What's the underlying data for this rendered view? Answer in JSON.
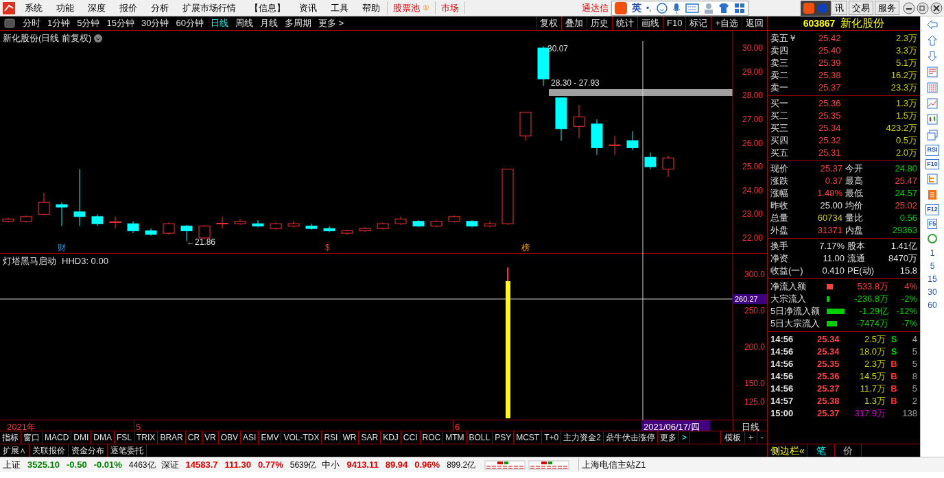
{
  "menu": {
    "items": [
      "系统",
      "功能",
      "深度",
      "报价",
      "分析",
      "扩展市场行情",
      "【信息】",
      "资讯",
      "工具",
      "帮助"
    ],
    "pool": "股票池",
    "pool_badge": "①",
    "market": "市场",
    "title": "通达信",
    "right_buttons": [
      "讯",
      "交易",
      "服务"
    ]
  },
  "ime_bar": {
    "label": "英",
    "punct": "•,"
  },
  "periods": [
    {
      "label": "分时",
      "selected": false
    },
    {
      "label": "1分钟",
      "selected": false
    },
    {
      "label": "5分钟",
      "selected": false
    },
    {
      "label": "15分钟",
      "selected": false
    },
    {
      "label": "30分钟",
      "selected": false
    },
    {
      "label": "60分钟",
      "selected": false
    },
    {
      "label": "日线",
      "selected": true
    },
    {
      "label": "周线",
      "selected": false
    },
    {
      "label": "月线",
      "selected": false
    },
    {
      "label": "多周期",
      "selected": false
    },
    {
      "label": "更多 >",
      "selected": false
    }
  ],
  "chart_tools": [
    "复权",
    "叠加",
    "历史",
    "统计",
    "画线",
    "F10",
    "标记",
    "+自选",
    "返回"
  ],
  "price_chart": {
    "title": "新化股份(日线 前复权)",
    "yticks": [
      "30.00",
      "29.00",
      "28.00",
      "27.00",
      "26.00",
      "25.00",
      "24.00",
      "23.00",
      "22.00"
    ],
    "high_label": "30.07",
    "range_label": "28.30 - 27.93",
    "low_label": "←21.86",
    "markers": [
      "财",
      "$",
      "榜"
    ]
  },
  "indicator_chart": {
    "title": "灯塔黑马启动",
    "reading": "HHD3: 0.00",
    "yticks": [
      "300.0",
      "250.0",
      "200.0",
      "150.0",
      "125.0"
    ],
    "cursor_label": "260.27"
  },
  "date_axis": {
    "labels": [
      "2021年",
      "5",
      "6"
    ],
    "cursor_date": "2021/06/17/四",
    "period": "日线"
  },
  "indicator_tabs": [
    "指标",
    "窗口",
    "MACD",
    "DMI",
    "DMA",
    "FSL",
    "TRIX",
    "BRAR",
    "CR",
    "VR",
    "OBV",
    "ASI",
    "EMV",
    "VOL-TDX",
    "RSI",
    "WR",
    "SAR",
    "KDJ",
    "CCI",
    "ROC",
    "MTM",
    "BOLL",
    "PSY",
    "MCST",
    "T+0",
    "主力资金2",
    "鼎牛伏击涨停",
    "更多"
  ],
  "indicator_more_arrow": ">",
  "template_buttons": [
    "模板",
    "+",
    "-"
  ],
  "bottom_tabs": [
    "扩展∧",
    "关联报价",
    "资金分布",
    "逐笔委托"
  ],
  "quote": {
    "code": "603867",
    "name": "新化股份",
    "sell": [
      {
        "label": "卖五￥",
        "price": "25.42",
        "volume": "2.3万"
      },
      {
        "label": "卖四",
        "price": "25.40",
        "volume": "3.3万"
      },
      {
        "label": "卖三",
        "price": "25.39",
        "volume": "5.1万"
      },
      {
        "label": "卖二",
        "price": "25.38",
        "volume": "16.2万"
      },
      {
        "label": "卖一",
        "price": "25.37",
        "volume": "23.3万"
      }
    ],
    "buy": [
      {
        "label": "买一",
        "price": "25.36",
        "volume": "1.3万"
      },
      {
        "label": "买二",
        "price": "25.35",
        "volume": "1.5万"
      },
      {
        "label": "买三",
        "price": "25.34",
        "volume": "423.2万"
      },
      {
        "label": "买四",
        "price": "25.32",
        "volume": "0.5万"
      },
      {
        "label": "买五",
        "price": "25.31",
        "volume": "2.0万"
      }
    ],
    "stats": [
      {
        "label": "现价",
        "value": "25.37",
        "color": "#ff4040"
      },
      {
        "label": "今开",
        "value": "24.80",
        "color": "#00d000"
      },
      {
        "label": "涨跌",
        "value": "0.37",
        "color": "#ff4040"
      },
      {
        "label": "最高",
        "value": "25.47",
        "color": "#ff4040"
      },
      {
        "label": "涨幅",
        "value": "1.48%",
        "color": "#ff4040"
      },
      {
        "label": "最低",
        "value": "24.57",
        "color": "#00d000"
      },
      {
        "label": "昨收",
        "value": "25.00",
        "color": "#e0e0e0"
      },
      {
        "label": "均价",
        "value": "25.02",
        "color": "#ff4040"
      },
      {
        "label": "总量",
        "value": "60734",
        "color": "#d0d000"
      },
      {
        "label": "量比",
        "value": "0.56",
        "color": "#00d000"
      },
      {
        "label": "外盘",
        "value": "31371",
        "color": "#ff4040"
      },
      {
        "label": "内盘",
        "value": "29363",
        "color": "#00d000"
      }
    ],
    "fundamentals": [
      {
        "label": "换手",
        "value": "7.17%",
        "label2": "股本",
        "value2": "1.41亿"
      },
      {
        "label": "净资",
        "value": "11.00",
        "label2": "流通",
        "value2": "8470万"
      },
      {
        "label": "收益(一)",
        "value": "0.410",
        "label2": "PE(动)",
        "value2": "15.8"
      }
    ],
    "flows": [
      {
        "label": "净流入额",
        "amount": "533.8万",
        "pct": "4%",
        "color": "#ff4040"
      },
      {
        "label": "大宗流入",
        "amount": "-236.8万",
        "pct": "-2%",
        "color": "#00d000"
      },
      {
        "label": "5日净流入额",
        "amount": "-1.29亿",
        "pct": "-12%",
        "color": "#00d000"
      },
      {
        "label": "5日大宗流入",
        "amount": "-7474万",
        "pct": "-7%",
        "color": "#00d000"
      }
    ],
    "ticks": [
      {
        "time": "14:56",
        "price": "25.34",
        "volume": "2.5万",
        "side": "S",
        "count": "4",
        "color": "#d0d000"
      },
      {
        "time": "14:56",
        "price": "25.34",
        "volume": "18.0万",
        "side": "S",
        "count": "5",
        "color": "#d0d000"
      },
      {
        "time": "14:56",
        "price": "25.35",
        "volume": "2.3万",
        "side": "B",
        "count": "5",
        "color": "#d0d000"
      },
      {
        "time": "14:56",
        "price": "25.36",
        "volume": "14.5万",
        "side": "B",
        "count": "8",
        "color": "#d0d000"
      },
      {
        "time": "14:56",
        "price": "25.37",
        "volume": "11.7万",
        "side": "B",
        "count": "5",
        "color": "#d0d000"
      },
      {
        "time": "14:57",
        "price": "25.38",
        "volume": "1.3万",
        "side": "B",
        "count": "2",
        "color": "#d0d000"
      },
      {
        "time": "15:00",
        "price": "25.37",
        "volume": "317.9万",
        "count": "138",
        "color": "#d000d0"
      }
    ],
    "sidebar_toggle": "侧边栏«",
    "sidebar_tabs": [
      {
        "label": "笔",
        "selected": true
      },
      {
        "label": "价",
        "selected": false
      }
    ]
  },
  "side_strip": {
    "labels": [
      "RSI",
      "F10",
      "F12",
      "F5"
    ],
    "periods": [
      "1",
      "5",
      "15",
      "30",
      "60"
    ]
  },
  "status_bar": {
    "indices": [
      {
        "name": "上证",
        "value": "3525.10",
        "change": "-0.50",
        "pct": "-0.01%",
        "amount": "4463亿",
        "color": "#008000"
      },
      {
        "name": "深证",
        "value": "14583.7",
        "change": "111.30",
        "pct": "0.77%",
        "amount": "5639亿",
        "color": "#e00000"
      },
      {
        "name": "中小",
        "value": "9413.11",
        "change": "89.94",
        "pct": "0.96%",
        "amount": "899.2亿",
        "color": "#e00000"
      }
    ],
    "server": "上海电信主站Z1"
  }
}
